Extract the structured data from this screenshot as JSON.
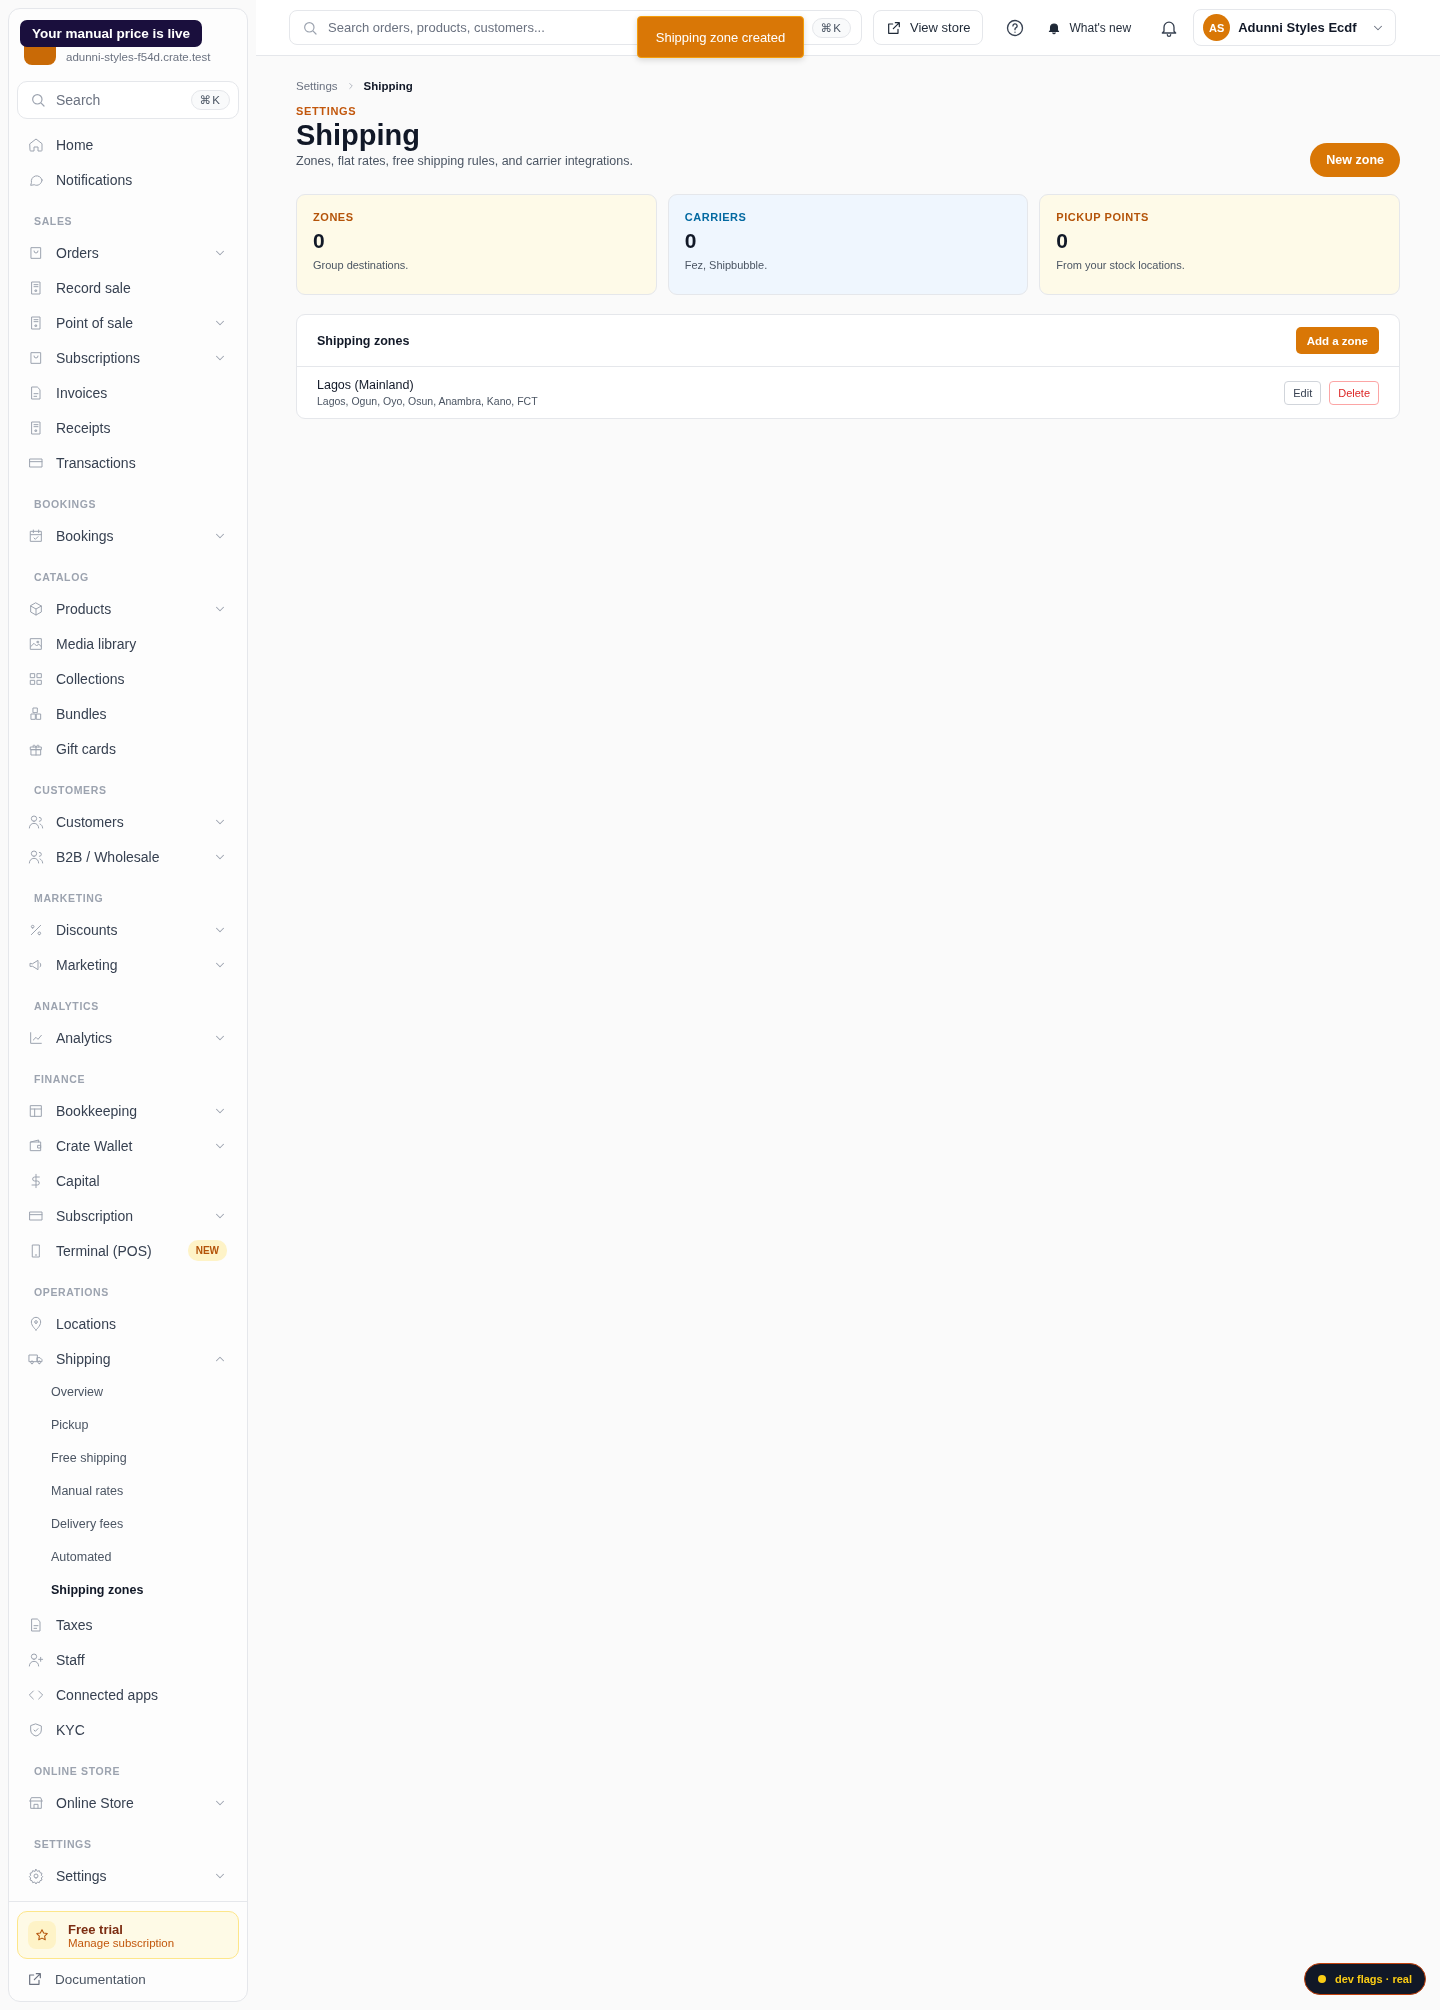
{
  "tooltip": {
    "text": "Your manual price is live"
  },
  "sidebar": {
    "store": {
      "subtitle": "adunni-styles-f54d.crate.test"
    },
    "search": {
      "placeholder": "Search",
      "shortcut": "⌘K"
    },
    "sections": [
      {
        "items": [
          {
            "label": "Home",
            "kind": "link"
          },
          {
            "label": "Notifications",
            "kind": "link"
          }
        ]
      },
      {
        "label": "SALES",
        "items": [
          {
            "label": "Orders",
            "kind": "menu",
            "expanded": false
          },
          {
            "label": "Record sale",
            "kind": "link"
          },
          {
            "label": "Point of sale",
            "kind": "menu",
            "expanded": false
          },
          {
            "label": "Subscriptions",
            "kind": "menu",
            "expanded": false
          },
          {
            "label": "Invoices",
            "kind": "link"
          },
          {
            "label": "Receipts",
            "kind": "link"
          },
          {
            "label": "Transactions",
            "kind": "link"
          }
        ]
      },
      {
        "label": "BOOKINGS",
        "items": [
          {
            "label": "Bookings",
            "kind": "menu",
            "expanded": false
          }
        ]
      },
      {
        "label": "CATALOG",
        "items": [
          {
            "label": "Products",
            "kind": "menu",
            "expanded": false
          },
          {
            "label": "Media library",
            "kind": "link"
          },
          {
            "label": "Collections",
            "kind": "link"
          },
          {
            "label": "Bundles",
            "kind": "link"
          },
          {
            "label": "Gift cards",
            "kind": "link"
          }
        ]
      },
      {
        "label": "CUSTOMERS",
        "items": [
          {
            "label": "Customers",
            "kind": "menu",
            "expanded": false
          },
          {
            "label": "B2B / Wholesale",
            "kind": "menu",
            "expanded": false
          }
        ]
      },
      {
        "label": "MARKETING",
        "items": [
          {
            "label": "Discounts",
            "kind": "menu",
            "expanded": false
          },
          {
            "label": "Marketing",
            "kind": "menu",
            "expanded": false
          }
        ]
      },
      {
        "label": "ANALYTICS",
        "items": [
          {
            "label": "Analytics",
            "kind": "menu",
            "expanded": false
          }
        ]
      },
      {
        "label": "FINANCE",
        "items": [
          {
            "label": "Bookkeeping",
            "kind": "menu",
            "expanded": false
          },
          {
            "label": "Crate Wallet",
            "kind": "menu",
            "expanded": false
          },
          {
            "label": "Capital",
            "kind": "link"
          },
          {
            "label": "Subscription",
            "kind": "menu",
            "expanded": false
          },
          {
            "label": "Terminal (POS)",
            "kind": "link",
            "badge": "NEW"
          }
        ]
      },
      {
        "label": "OPERATIONS",
        "items": [
          {
            "label": "Locations",
            "kind": "link"
          },
          {
            "label": "Shipping",
            "kind": "menu",
            "expanded": true,
            "children": [
              {
                "label": "Overview",
                "selected": false
              },
              {
                "label": "Pickup",
                "selected": false
              },
              {
                "label": "Free shipping",
                "selected": false
              },
              {
                "label": "Manual rates",
                "selected": false
              },
              {
                "label": "Delivery fees",
                "selected": false
              },
              {
                "label": "Automated",
                "selected": false
              },
              {
                "label": "Shipping zones",
                "selected": true
              }
            ]
          },
          {
            "label": "Taxes",
            "kind": "link"
          },
          {
            "label": "Staff",
            "kind": "link"
          },
          {
            "label": "Connected apps",
            "kind": "link"
          },
          {
            "label": "KYC",
            "kind": "link"
          }
        ]
      },
      {
        "label": "ONLINE STORE",
        "items": [
          {
            "label": "Online Store",
            "kind": "menu",
            "expanded": false
          }
        ]
      },
      {
        "label": "SETTINGS",
        "items": [
          {
            "label": "Settings",
            "kind": "menu",
            "expanded": false
          }
        ]
      }
    ],
    "trial": {
      "title": "Free trial",
      "link": "Manage subscription"
    },
    "documentation": "Documentation"
  },
  "topbar": {
    "search": {
      "placeholder": "Search orders, products, customers...",
      "shortcut": "⌘K"
    },
    "toast": "Shipping zone created",
    "view_store": "View store",
    "whats_new": "What's new",
    "account": {
      "initials": "AS",
      "name": "Adunni Styles Ecdf"
    }
  },
  "page": {
    "breadcrumb": [
      "Settings",
      "Shipping"
    ],
    "eyebrow": "SETTINGS",
    "title": "Shipping",
    "subtitle": "Zones, flat rates, free shipping rules, and carrier integrations.",
    "new_button": "New zone",
    "stats": [
      {
        "label": "ZONES",
        "value": "0",
        "note": "Group destinations.",
        "kind": "amber",
        "color": "#b45309"
      },
      {
        "label": "CARRIERS",
        "value": "0",
        "note": "Fez, Shipbubble.",
        "kind": "blue",
        "color": "#0369a1"
      },
      {
        "label": "PICKUP POINTS",
        "value": "0",
        "note": "From your stock locations.",
        "kind": "amber",
        "color": "#b45309"
      }
    ],
    "zones": {
      "title": "Shipping zones",
      "add_button": "Add a zone",
      "rows": [
        {
          "name": "Lagos (Mainland)",
          "regions": "Lagos, Ogun, Oyo, Osun, Anambra, Kano, FCT",
          "edit": "Edit",
          "delete": "Delete"
        }
      ]
    }
  },
  "dev_flags": {
    "label": "dev flags · real"
  }
}
